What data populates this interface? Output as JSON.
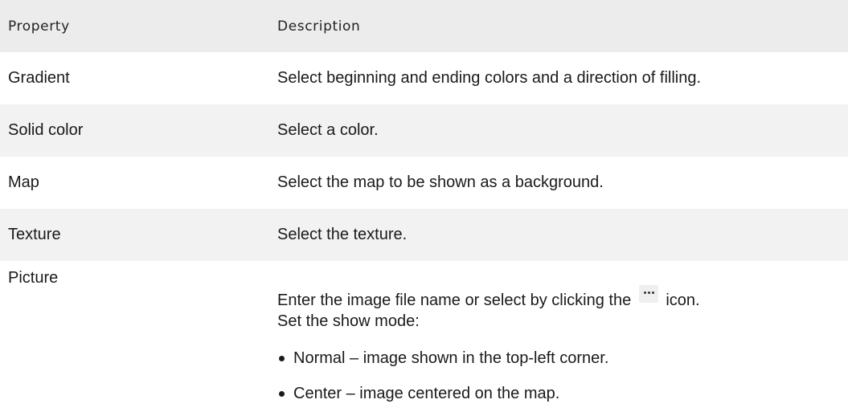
{
  "header": {
    "property": "Property",
    "description": "Description"
  },
  "rows": [
    {
      "property": "Gradient",
      "description": "Select beginning and ending colors and a direction of filling."
    },
    {
      "property": "Solid color",
      "description": "Select a color."
    },
    {
      "property": "Map",
      "description": "Select the map to be shown as a background."
    },
    {
      "property": "Texture",
      "description": "Select the texture."
    }
  ],
  "picture": {
    "property": "Picture",
    "line1_before": "Enter the image file name or select by clicking the",
    "icon": "ellipsis-icon",
    "line1_after": "icon.",
    "line2": "Set the show mode:",
    "modes": [
      "Normal – image shown in the top-left corner.",
      "Center – image centered on the map."
    ]
  }
}
